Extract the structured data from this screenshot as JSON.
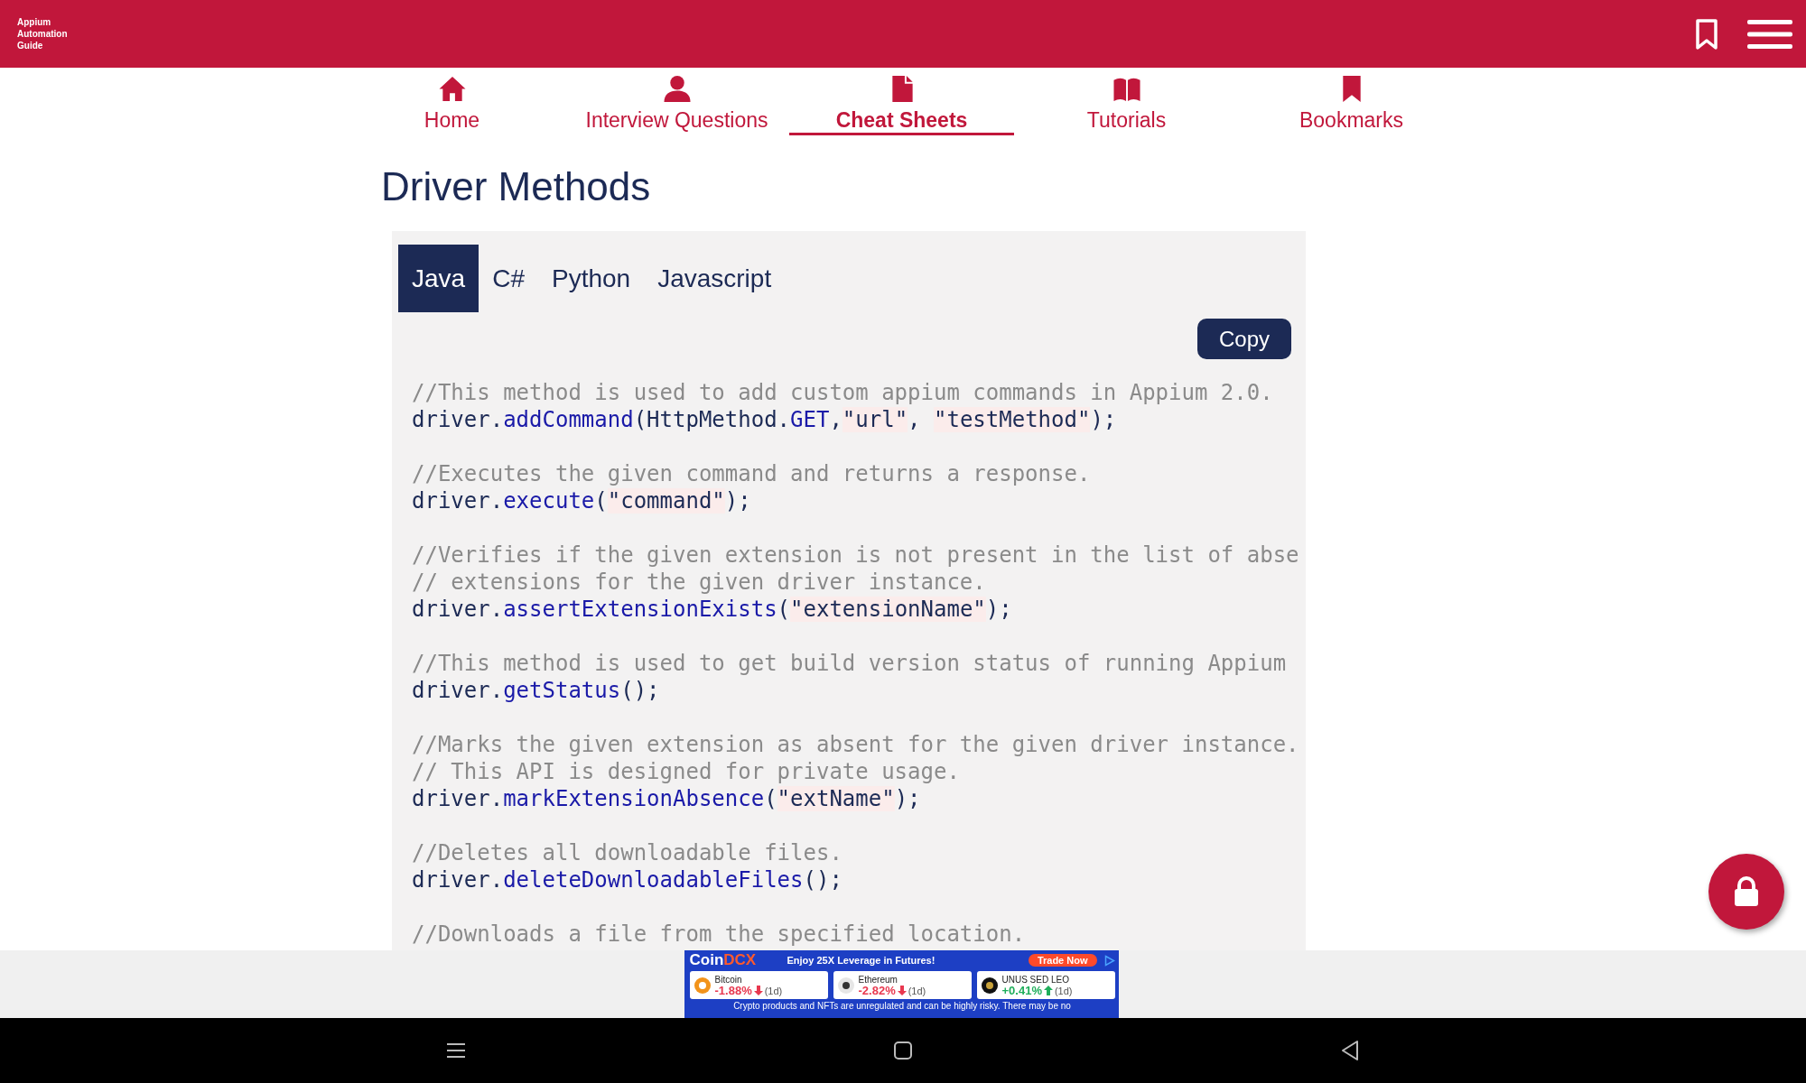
{
  "header": {
    "logo_lines": [
      "Appium",
      "Automation",
      "Guide"
    ]
  },
  "nav": [
    {
      "label": "Home",
      "selected": false
    },
    {
      "label": "Interview Questions",
      "selected": false
    },
    {
      "label": "Cheat Sheets",
      "selected": true
    },
    {
      "label": "Tutorials",
      "selected": false
    },
    {
      "label": "Bookmarks",
      "selected": false
    }
  ],
  "title": "Driver Methods",
  "language_tabs": [
    {
      "label": "Java",
      "selected": true
    },
    {
      "label": "C#",
      "selected": false
    },
    {
      "label": "Python",
      "selected": false
    },
    {
      "label": "Javascript",
      "selected": false
    }
  ],
  "copy_button": "Copy",
  "code_blocks": [
    {
      "lines": [
        [
          {
            "kind": "comment",
            "text": "//This method is used to add custom appium commands in Appium 2.0."
          }
        ],
        [
          {
            "kind": "plain",
            "text": "driver."
          },
          {
            "kind": "method",
            "text": "addCommand"
          },
          {
            "kind": "plain",
            "text": "(HttpMethod."
          },
          {
            "kind": "method",
            "text": "GET"
          },
          {
            "kind": "plain",
            "text": ","
          },
          {
            "kind": "string",
            "text": "\"url\""
          },
          {
            "kind": "plain",
            "text": ", "
          },
          {
            "kind": "string",
            "text": "\"testMethod\""
          },
          {
            "kind": "plain",
            "text": ");"
          }
        ]
      ]
    },
    {
      "lines": [
        [
          {
            "kind": "comment",
            "text": "//Executes the given command and returns a response."
          }
        ],
        [
          {
            "kind": "plain",
            "text": "driver."
          },
          {
            "kind": "method",
            "text": "execute"
          },
          {
            "kind": "plain",
            "text": "("
          },
          {
            "kind": "string",
            "text": "\"command\""
          },
          {
            "kind": "plain",
            "text": ");"
          }
        ]
      ]
    },
    {
      "lines": [
        [
          {
            "kind": "comment",
            "text": "//Verifies if the given extension is not present in the list of abse"
          }
        ],
        [
          {
            "kind": "comment",
            "text": "// extensions for the given driver instance."
          }
        ],
        [
          {
            "kind": "plain",
            "text": "driver."
          },
          {
            "kind": "method",
            "text": "assertExtensionExists"
          },
          {
            "kind": "plain",
            "text": "("
          },
          {
            "kind": "string",
            "text": "\"extensionName\""
          },
          {
            "kind": "plain",
            "text": ");"
          }
        ]
      ]
    },
    {
      "lines": [
        [
          {
            "kind": "comment",
            "text": "//This method is used to get build version status of running Appium"
          }
        ],
        [
          {
            "kind": "plain",
            "text": "driver."
          },
          {
            "kind": "method",
            "text": "getStatus"
          },
          {
            "kind": "plain",
            "text": "();"
          }
        ]
      ]
    },
    {
      "lines": [
        [
          {
            "kind": "comment",
            "text": "//Marks the given extension as absent for the given driver instance."
          }
        ],
        [
          {
            "kind": "comment",
            "text": "// This API is designed for private usage."
          }
        ],
        [
          {
            "kind": "plain",
            "text": "driver."
          },
          {
            "kind": "method",
            "text": "markExtensionAbsence"
          },
          {
            "kind": "plain",
            "text": "("
          },
          {
            "kind": "string",
            "text": "\"extName\""
          },
          {
            "kind": "plain",
            "text": ");"
          }
        ]
      ]
    },
    {
      "lines": [
        [
          {
            "kind": "comment",
            "text": "//Deletes all downloadable files."
          }
        ],
        [
          {
            "kind": "plain",
            "text": "driver."
          },
          {
            "kind": "method",
            "text": "deleteDownloadableFiles"
          },
          {
            "kind": "plain",
            "text": "();"
          }
        ]
      ]
    },
    {
      "lines": [
        [
          {
            "kind": "comment",
            "text": "//Downloads a file from the specified location."
          }
        ]
      ]
    }
  ],
  "ad": {
    "logo_parts": [
      "Coin",
      "DCX"
    ],
    "headline": "Enjoy 25X Leverage in Futures!",
    "cta": "Trade Now",
    "coins": [
      {
        "name": "Bitcoin",
        "change": "-1.88%",
        "period": "(1d)",
        "kind": "down"
      },
      {
        "name": "Ethereum",
        "change": "-2.82%",
        "period": "(1d)",
        "kind": "down"
      },
      {
        "name": "UNUS SED LEO",
        "change": "+0.41%",
        "period": "(1d)",
        "kind": "up"
      }
    ],
    "disclaimer": "Crypto products and NFTs are unregulated and can be highly risky. There may be no"
  }
}
